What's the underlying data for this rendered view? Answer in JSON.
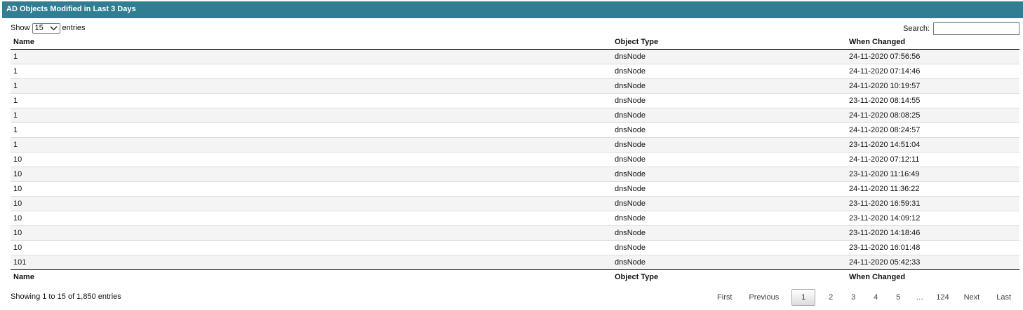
{
  "header": {
    "title": "AD Objects Modified in Last 3 Days"
  },
  "length_menu": {
    "prefix": "Show",
    "value": "15",
    "suffix": "entries"
  },
  "search": {
    "label": "Search:",
    "value": "",
    "placeholder": ""
  },
  "table": {
    "columns": [
      "Name",
      "Object Type",
      "When Changed"
    ],
    "rows": [
      [
        "1",
        "dnsNode",
        "24-11-2020 07:56:56"
      ],
      [
        "1",
        "dnsNode",
        "24-11-2020 07:14:46"
      ],
      [
        "1",
        "dnsNode",
        "24-11-2020 10:19:57"
      ],
      [
        "1",
        "dnsNode",
        "23-11-2020 08:14:55"
      ],
      [
        "1",
        "dnsNode",
        "24-11-2020 08:08:25"
      ],
      [
        "1",
        "dnsNode",
        "24-11-2020 08:24:57"
      ],
      [
        "1",
        "dnsNode",
        "23-11-2020 14:51:04"
      ],
      [
        "10",
        "dnsNode",
        "24-11-2020 07:12:11"
      ],
      [
        "10",
        "dnsNode",
        "23-11-2020 11:16:49"
      ],
      [
        "10",
        "dnsNode",
        "24-11-2020 11:36:22"
      ],
      [
        "10",
        "dnsNode",
        "23-11-2020 16:59:31"
      ],
      [
        "10",
        "dnsNode",
        "23-11-2020 14:09:12"
      ],
      [
        "10",
        "dnsNode",
        "23-11-2020 14:18:46"
      ],
      [
        "10",
        "dnsNode",
        "23-11-2020 16:01:48"
      ],
      [
        "101",
        "dnsNode",
        "24-11-2020 05:42:33"
      ]
    ]
  },
  "info": "Showing 1 to 15 of 1,850 entries",
  "pagination": {
    "first": "First",
    "previous": "Previous",
    "pages": [
      "1",
      "2",
      "3",
      "4",
      "5"
    ],
    "current_page": "1",
    "ellipsis": "…",
    "last_page": "124",
    "next": "Next",
    "last": "Last"
  },
  "colors": {
    "header_bg": "#317e93",
    "header_text": "#ffffff",
    "row_odd": "#f4f4f4",
    "row_even": "#ffffff"
  },
  "icons": {
    "select": "chevron-down-icon"
  }
}
